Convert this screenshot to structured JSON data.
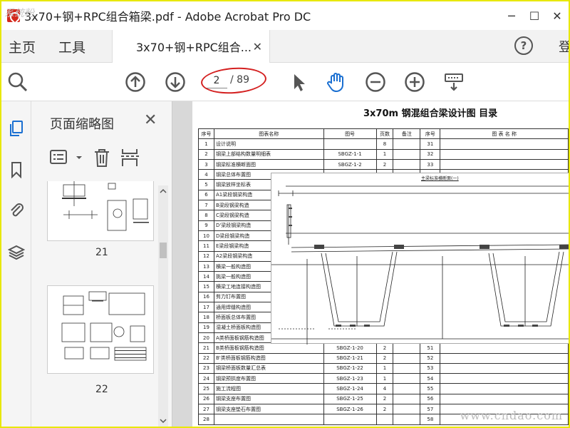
{
  "window": {
    "title": "3x70+钢+RPC组合箱梁.pdf - Adobe Acrobat Pro DC",
    "minimize": "─",
    "restore": "☐",
    "close": "✕"
  },
  "tabs": {
    "home": "主页",
    "tools": "工具",
    "document": "3x70+钢+RPC组合...",
    "document_close": "✕",
    "help": "?",
    "login": "登"
  },
  "toolbar": {
    "current_page": "2",
    "total_pages": "/ 89"
  },
  "panel": {
    "title": "页面缩略图",
    "close": "✕",
    "thumb_labels": [
      "21",
      "22"
    ]
  },
  "document": {
    "heading": "3x70m 钢混组合梁设计图 目录",
    "overlay_title": "主梁标准横断面(一)",
    "toc_headers": [
      "序号",
      "图表名称",
      "图号",
      "页数",
      "备注",
      "序号",
      "图 表 名 称"
    ],
    "toc_rows": [
      [
        "1",
        "设计说明",
        "",
        "8",
        "",
        "31"
      ],
      [
        "2",
        "钢梁上部结构数量明细表",
        "SBGZ-1-1",
        "1",
        "",
        "32"
      ],
      [
        "3",
        "钢梁标准横断面图",
        "SBGZ-1-2",
        "2",
        "",
        "33"
      ],
      [
        "4",
        "钢梁总体布置图",
        "",
        "",
        "",
        ""
      ],
      [
        "5",
        "钢梁放样坐标表",
        "",
        "",
        "",
        ""
      ],
      [
        "6",
        "A1梁段钢梁构造",
        "",
        "",
        "",
        ""
      ],
      [
        "7",
        "B梁段钢梁构造",
        "",
        "",
        "",
        ""
      ],
      [
        "8",
        "C梁段钢梁构造",
        "",
        "",
        "",
        ""
      ],
      [
        "9",
        "D'梁段钢梁构造",
        "",
        "",
        "",
        ""
      ],
      [
        "10",
        "D梁段钢梁构造",
        "",
        "",
        "",
        ""
      ],
      [
        "11",
        "E梁段钢梁构造",
        "",
        "",
        "",
        ""
      ],
      [
        "12",
        "A2梁段钢梁构造",
        "",
        "",
        "",
        ""
      ],
      [
        "13",
        "横梁一般构造图",
        "",
        "",
        "",
        ""
      ],
      [
        "14",
        "挑梁一般构造图",
        "",
        "",
        "",
        ""
      ],
      [
        "15",
        "横梁工地连接构造图",
        "",
        "",
        "",
        ""
      ],
      [
        "16",
        "剪力钉布置图",
        "",
        "",
        "",
        ""
      ],
      [
        "17",
        "通用焊缝构造图",
        "",
        "",
        "",
        ""
      ],
      [
        "18",
        "桥面板总体布置图",
        "",
        "",
        "",
        ""
      ],
      [
        "19",
        "湿凝土桥面板构造图",
        "",
        "",
        "",
        ""
      ],
      [
        "20",
        "A类桥面板钢筋构造图",
        "",
        "",
        "",
        ""
      ],
      [
        "21",
        "B类桥面板钢筋构造图",
        "SBGZ-1-20",
        "2",
        "",
        "51"
      ],
      [
        "22",
        "B'类桥面板钢筋构造图",
        "SBGZ-1-21",
        "2",
        "",
        "52"
      ],
      [
        "23",
        "钢梁桥面板数量汇总表",
        "SBGZ-1-22",
        "1",
        "",
        "53"
      ],
      [
        "24",
        "钢梁预拱度布置图",
        "SBGZ-1-23",
        "1",
        "",
        "54"
      ],
      [
        "25",
        "施工流程图",
        "SBGZ-1-24",
        "4",
        "",
        "55"
      ],
      [
        "26",
        "钢梁支座布置图",
        "SBGZ-1-25",
        "2",
        "",
        "56"
      ],
      [
        "27",
        "钢梁支座垫石布置图",
        "SBGZ-1-26",
        "2",
        "",
        "57"
      ],
      [
        "28",
        "",
        "",
        "",
        "",
        "58"
      ]
    ]
  },
  "watermarks": {
    "bottom": "www.cndao.com",
    "top": "系统粉"
  },
  "colors": {
    "outer_border": "#e8e800",
    "annotation": "#d42020",
    "acrobat_red": "#d4281c"
  }
}
